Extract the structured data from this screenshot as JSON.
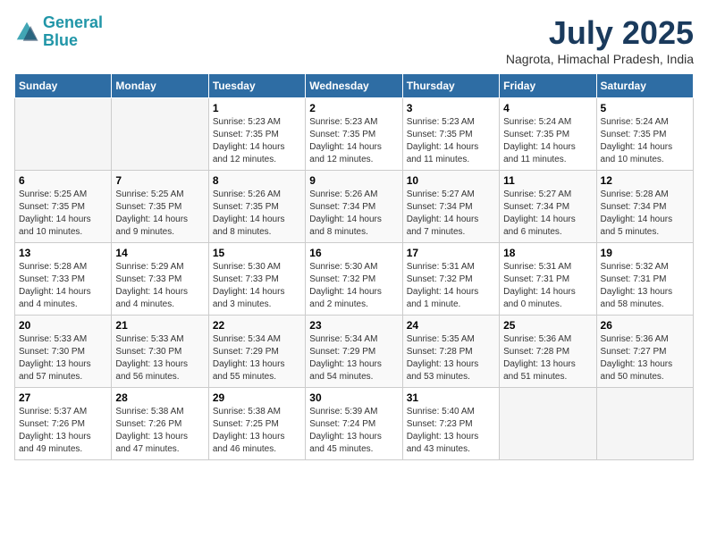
{
  "logo": {
    "line1": "General",
    "line2": "Blue"
  },
  "title": "July 2025",
  "subtitle": "Nagrota, Himachal Pradesh, India",
  "weekdays": [
    "Sunday",
    "Monday",
    "Tuesday",
    "Wednesday",
    "Thursday",
    "Friday",
    "Saturday"
  ],
  "weeks": [
    [
      {
        "day": null
      },
      {
        "day": null
      },
      {
        "day": "1",
        "sunrise": "5:23 AM",
        "sunset": "7:35 PM",
        "daylight": "14 hours and 12 minutes."
      },
      {
        "day": "2",
        "sunrise": "5:23 AM",
        "sunset": "7:35 PM",
        "daylight": "14 hours and 12 minutes."
      },
      {
        "day": "3",
        "sunrise": "5:23 AM",
        "sunset": "7:35 PM",
        "daylight": "14 hours and 11 minutes."
      },
      {
        "day": "4",
        "sunrise": "5:24 AM",
        "sunset": "7:35 PM",
        "daylight": "14 hours and 11 minutes."
      },
      {
        "day": "5",
        "sunrise": "5:24 AM",
        "sunset": "7:35 PM",
        "daylight": "14 hours and 10 minutes."
      }
    ],
    [
      {
        "day": "6",
        "sunrise": "5:25 AM",
        "sunset": "7:35 PM",
        "daylight": "14 hours and 10 minutes."
      },
      {
        "day": "7",
        "sunrise": "5:25 AM",
        "sunset": "7:35 PM",
        "daylight": "14 hours and 9 minutes."
      },
      {
        "day": "8",
        "sunrise": "5:26 AM",
        "sunset": "7:35 PM",
        "daylight": "14 hours and 8 minutes."
      },
      {
        "day": "9",
        "sunrise": "5:26 AM",
        "sunset": "7:34 PM",
        "daylight": "14 hours and 8 minutes."
      },
      {
        "day": "10",
        "sunrise": "5:27 AM",
        "sunset": "7:34 PM",
        "daylight": "14 hours and 7 minutes."
      },
      {
        "day": "11",
        "sunrise": "5:27 AM",
        "sunset": "7:34 PM",
        "daylight": "14 hours and 6 minutes."
      },
      {
        "day": "12",
        "sunrise": "5:28 AM",
        "sunset": "7:34 PM",
        "daylight": "14 hours and 5 minutes."
      }
    ],
    [
      {
        "day": "13",
        "sunrise": "5:28 AM",
        "sunset": "7:33 PM",
        "daylight": "14 hours and 4 minutes."
      },
      {
        "day": "14",
        "sunrise": "5:29 AM",
        "sunset": "7:33 PM",
        "daylight": "14 hours and 4 minutes."
      },
      {
        "day": "15",
        "sunrise": "5:30 AM",
        "sunset": "7:33 PM",
        "daylight": "14 hours and 3 minutes."
      },
      {
        "day": "16",
        "sunrise": "5:30 AM",
        "sunset": "7:32 PM",
        "daylight": "14 hours and 2 minutes."
      },
      {
        "day": "17",
        "sunrise": "5:31 AM",
        "sunset": "7:32 PM",
        "daylight": "14 hours and 1 minute."
      },
      {
        "day": "18",
        "sunrise": "5:31 AM",
        "sunset": "7:31 PM",
        "daylight": "14 hours and 0 minutes."
      },
      {
        "day": "19",
        "sunrise": "5:32 AM",
        "sunset": "7:31 PM",
        "daylight": "13 hours and 58 minutes."
      }
    ],
    [
      {
        "day": "20",
        "sunrise": "5:33 AM",
        "sunset": "7:30 PM",
        "daylight": "13 hours and 57 minutes."
      },
      {
        "day": "21",
        "sunrise": "5:33 AM",
        "sunset": "7:30 PM",
        "daylight": "13 hours and 56 minutes."
      },
      {
        "day": "22",
        "sunrise": "5:34 AM",
        "sunset": "7:29 PM",
        "daylight": "13 hours and 55 minutes."
      },
      {
        "day": "23",
        "sunrise": "5:34 AM",
        "sunset": "7:29 PM",
        "daylight": "13 hours and 54 minutes."
      },
      {
        "day": "24",
        "sunrise": "5:35 AM",
        "sunset": "7:28 PM",
        "daylight": "13 hours and 53 minutes."
      },
      {
        "day": "25",
        "sunrise": "5:36 AM",
        "sunset": "7:28 PM",
        "daylight": "13 hours and 51 minutes."
      },
      {
        "day": "26",
        "sunrise": "5:36 AM",
        "sunset": "7:27 PM",
        "daylight": "13 hours and 50 minutes."
      }
    ],
    [
      {
        "day": "27",
        "sunrise": "5:37 AM",
        "sunset": "7:26 PM",
        "daylight": "13 hours and 49 minutes."
      },
      {
        "day": "28",
        "sunrise": "5:38 AM",
        "sunset": "7:26 PM",
        "daylight": "13 hours and 47 minutes."
      },
      {
        "day": "29",
        "sunrise": "5:38 AM",
        "sunset": "7:25 PM",
        "daylight": "13 hours and 46 minutes."
      },
      {
        "day": "30",
        "sunrise": "5:39 AM",
        "sunset": "7:24 PM",
        "daylight": "13 hours and 45 minutes."
      },
      {
        "day": "31",
        "sunrise": "5:40 AM",
        "sunset": "7:23 PM",
        "daylight": "13 hours and 43 minutes."
      },
      {
        "day": null
      },
      {
        "day": null
      }
    ]
  ]
}
